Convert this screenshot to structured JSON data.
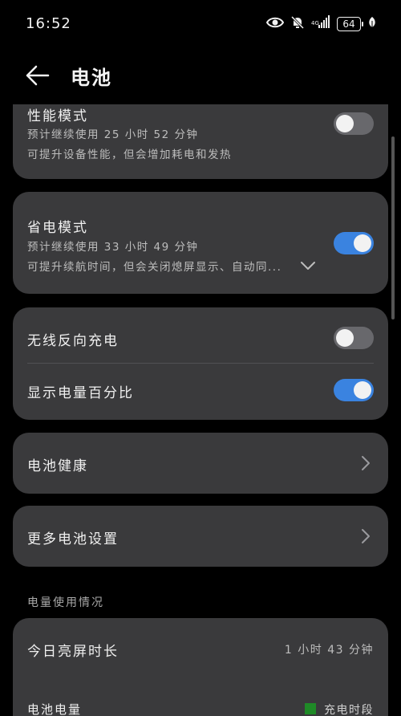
{
  "status_bar": {
    "time": "16:52",
    "battery_level": "64"
  },
  "header": {
    "title": "电池"
  },
  "performance_mode": {
    "title": "性能模式",
    "estimate": "预计继续使用 25 小时 52 分钟",
    "description": "可提升设备性能，但会增加耗电和发热",
    "enabled": false
  },
  "power_saving_mode": {
    "title": "省电模式",
    "estimate": "预计继续使用 33 小时 49 分钟",
    "description": "可提升续航时间，但会关闭熄屏显示、自动同...",
    "enabled": true
  },
  "wireless_reverse_charging": {
    "title": "无线反向充电",
    "enabled": false
  },
  "show_battery_percentage": {
    "title": "显示电量百分比",
    "enabled": true
  },
  "battery_health": {
    "title": "电池健康"
  },
  "more_battery_settings": {
    "title": "更多电池设置"
  },
  "usage_section": {
    "label": "电量使用情况",
    "screen_on_title": "今日亮屏时长",
    "screen_on_value": "1 小时 43 分钟",
    "battery_level_label": "电池电量",
    "legend_charging": "充电时段",
    "legend_color": "#1f8a27"
  },
  "colors": {
    "toggle_on": "#3a83e0",
    "toggle_off": "#68686c",
    "card_bg": "#3a3a3c"
  }
}
